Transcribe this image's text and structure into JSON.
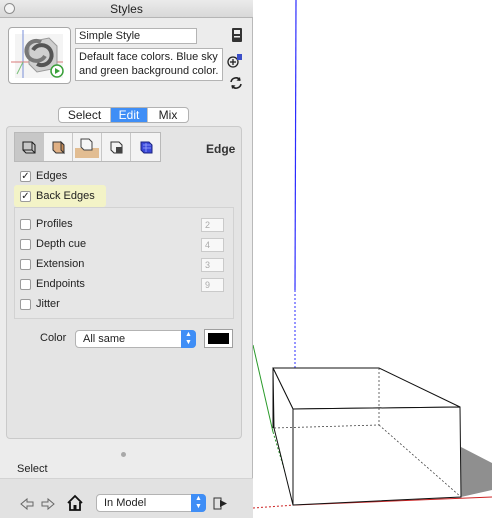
{
  "window": {
    "title": "Styles"
  },
  "style": {
    "name": "Simple Style",
    "description": "Default face colors. Blue sky and green background color."
  },
  "tabs": [
    {
      "label": "Select",
      "active": false
    },
    {
      "label": "Edit",
      "active": true
    },
    {
      "label": "Mix",
      "active": false
    }
  ],
  "edit_toolbar": {
    "icons": [
      "edge-settings-icon",
      "face-settings-icon",
      "background-settings-icon",
      "watermark-settings-icon",
      "modeling-settings-icon"
    ],
    "active_index": 0
  },
  "section_title": "Edge",
  "edges": [
    {
      "label": "Edges",
      "checked": true
    },
    {
      "label": "Back Edges",
      "checked": true
    }
  ],
  "properties": [
    {
      "label": "Profiles",
      "checked": false,
      "value": "2"
    },
    {
      "label": "Depth cue",
      "checked": false,
      "value": "4"
    },
    {
      "label": "Extension",
      "checked": false,
      "value": "3"
    },
    {
      "label": "Endpoints",
      "checked": false,
      "value": "9"
    },
    {
      "label": "Jitter",
      "checked": false,
      "value": ""
    }
  ],
  "color": {
    "label": "Color",
    "value": "All same",
    "swatch": "#000000"
  },
  "select_section": {
    "label": "Select",
    "location": "In Model"
  },
  "colors": {
    "accent": "#3f8ef6",
    "highlight": "#f3f3c7",
    "axis_blue": "#2b2bff",
    "axis_green": "#2a9a2a",
    "axis_red": "#cc2222"
  }
}
